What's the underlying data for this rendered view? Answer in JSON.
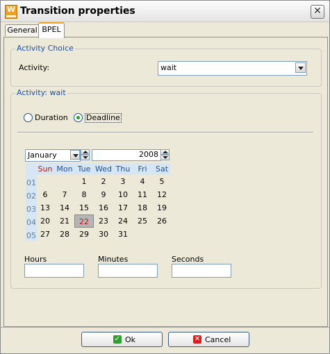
{
  "window": {
    "title": "Transition properties",
    "app_icon_letter": "W"
  },
  "tabs": [
    {
      "label": "General"
    },
    {
      "label": "BPEL"
    }
  ],
  "activity_choice": {
    "legend": "Activity Choice",
    "label": "Activity:",
    "selected": "wait"
  },
  "activity_wait": {
    "legend": "Activity: wait",
    "radio_duration": "Duration",
    "radio_deadline": "Deadline",
    "selected_radio": "Deadline"
  },
  "calendar": {
    "month": "January",
    "year": "2008",
    "weekdays": [
      "Sun",
      "Mon",
      "Tue",
      "Wed",
      "Thu",
      "Fri",
      "Sat"
    ],
    "weeks": [
      {
        "num": "01",
        "days": [
          "",
          "",
          "1",
          "2",
          "3",
          "4",
          "5"
        ]
      },
      {
        "num": "02",
        "days": [
          "6",
          "7",
          "8",
          "9",
          "10",
          "11",
          "12"
        ]
      },
      {
        "num": "03",
        "days": [
          "13",
          "14",
          "15",
          "16",
          "17",
          "18",
          "19"
        ]
      },
      {
        "num": "04",
        "days": [
          "20",
          "21",
          "22",
          "23",
          "24",
          "25",
          "26"
        ]
      },
      {
        "num": "05",
        "days": [
          "27",
          "28",
          "29",
          "30",
          "31",
          "",
          ""
        ]
      }
    ],
    "selected_day": "22"
  },
  "time": {
    "hours_label": "Hours",
    "hours_value": "",
    "minutes_label": "Minutes",
    "minutes_value": "",
    "seconds_label": "Seconds",
    "seconds_value": ""
  },
  "buttons": {
    "ok": "Ok",
    "cancel": "Cancel"
  },
  "colors": {
    "legend": "#1f4fa0",
    "sunday": "#b01818",
    "weekday": "#1f4fa0",
    "ok_icon": "#2f9e2f",
    "cancel_icon": "#d42020"
  }
}
